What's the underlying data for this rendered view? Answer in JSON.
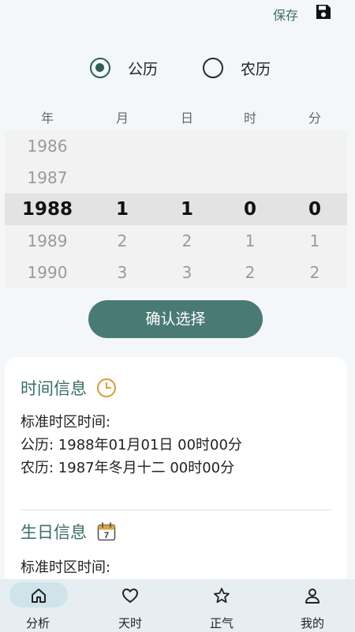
{
  "header": {
    "save_label": "保存",
    "save_icon": "floppy-disk-icon"
  },
  "calendar_type": {
    "options": [
      {
        "label": "公历",
        "checked": true
      },
      {
        "label": "农历",
        "checked": false
      }
    ]
  },
  "picker": {
    "columns": [
      "年",
      "月",
      "日",
      "时",
      "分"
    ],
    "rows": [
      [
        "1986",
        "",
        "",
        "",
        ""
      ],
      [
        "1987",
        "",
        "",
        "",
        ""
      ],
      [
        "1988",
        "1",
        "1",
        "0",
        "0"
      ],
      [
        "1989",
        "2",
        "2",
        "1",
        "1"
      ],
      [
        "1990",
        "3",
        "3",
        "2",
        "2"
      ]
    ],
    "selected_row": 2
  },
  "confirm_label": "确认选择",
  "time_info": {
    "title": "时间信息",
    "icon": "clock-icon",
    "lines": [
      "标准时区时间:",
      "公历: 1988年01月01日 00时00分",
      "农历: 1987年冬月十二 00时00分"
    ]
  },
  "birthday_info": {
    "title": "生日信息",
    "icon": "calendar-icon",
    "calendar_day": "7",
    "lines": [
      "标准时区时间:"
    ]
  },
  "nav": {
    "items": [
      {
        "label": "分析",
        "icon": "home-icon",
        "active": true
      },
      {
        "label": "天时",
        "icon": "heart-icon",
        "active": false
      },
      {
        "label": "正气",
        "icon": "star-icon",
        "active": false
      },
      {
        "label": "我的",
        "icon": "person-icon",
        "active": false
      }
    ]
  },
  "colors": {
    "accent": "#4a7a74",
    "title": "#3c6e68",
    "icon_gold": "#d9a441"
  }
}
